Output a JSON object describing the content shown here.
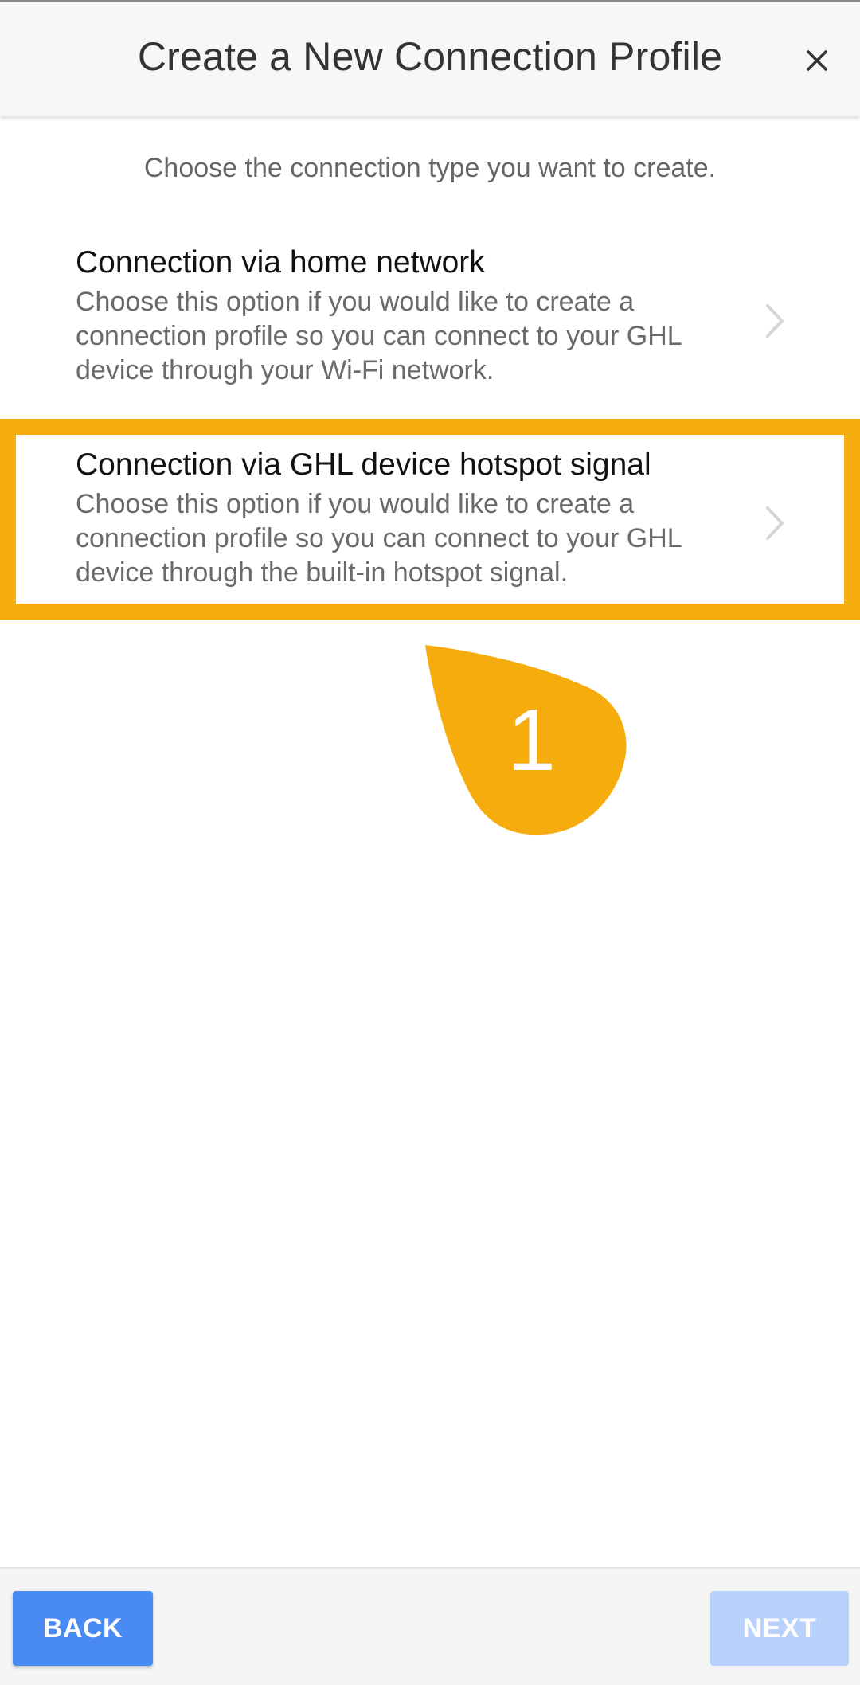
{
  "header": {
    "title": "Create a New Connection Profile",
    "close_icon": "close-icon"
  },
  "subtitle": "Choose the connection type you want to create.",
  "options": [
    {
      "title": "Connection via home network",
      "description": "Choose this option if you would like to create a connection profile so you can connect to your GHL device through your Wi-Fi network.",
      "icon": "chevron-right-icon"
    },
    {
      "title": "Connection via GHL device hotspot signal",
      "description": "Choose this option if you would like to create a connection profile so you can connect to your GHL device through the built-in hotspot signal.",
      "icon": "chevron-right-icon",
      "highlighted": true
    }
  ],
  "callout": {
    "number": "1",
    "color": "#f6ac0c"
  },
  "footer": {
    "back_label": "BACK",
    "next_label": "NEXT",
    "back_color": "#4a8af4",
    "next_color": "#b9d2fb",
    "next_enabled": false
  }
}
